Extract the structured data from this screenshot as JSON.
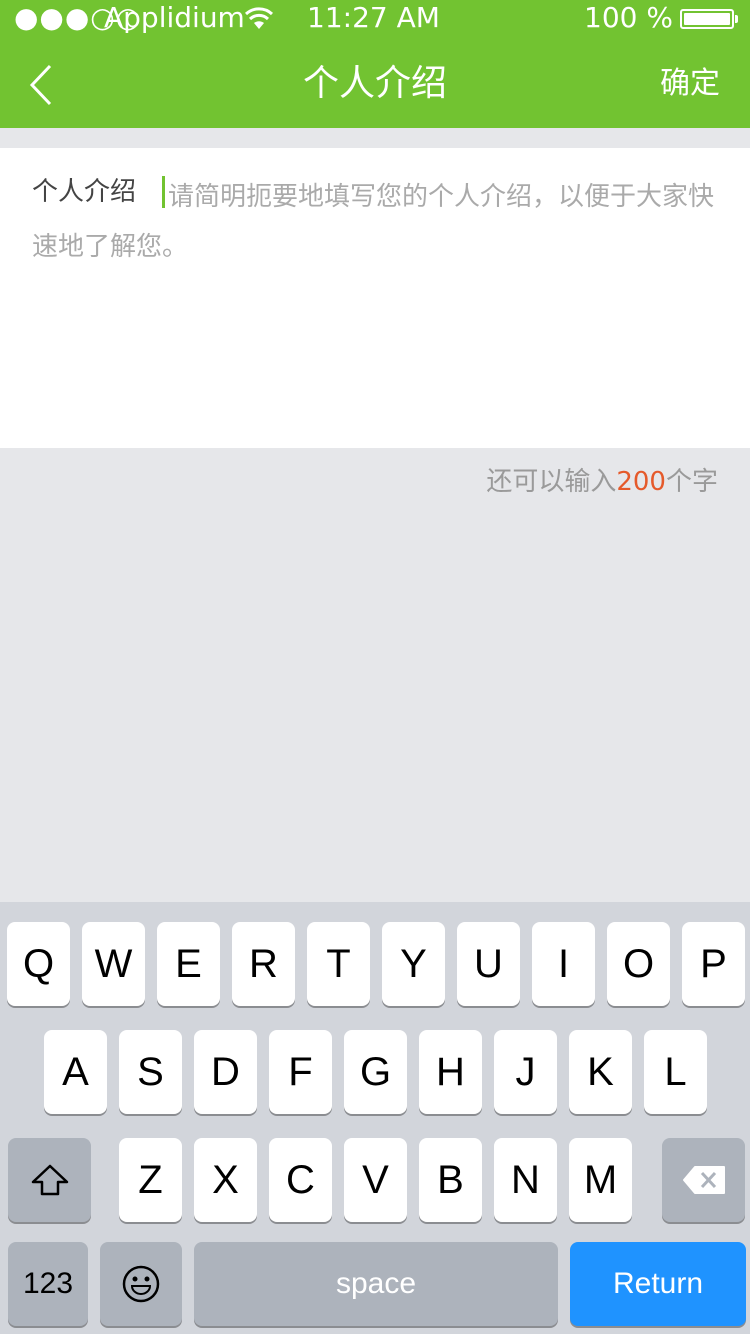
{
  "status_bar": {
    "signal": "●●●○○",
    "carrier": "Applidium",
    "time": "11:27 AM",
    "battery_percent": "100 %"
  },
  "nav": {
    "title": "个人介绍",
    "confirm_label": "确定"
  },
  "intro": {
    "label": "个人介绍",
    "placeholder": "请简明扼要地填写您的个人介绍，以便于大家快速地了解您。"
  },
  "counter": {
    "prefix": "还可以输入",
    "count": "200",
    "suffix": "个字"
  },
  "keyboard": {
    "row1": [
      "Q",
      "W",
      "E",
      "R",
      "T",
      "Y",
      "U",
      "I",
      "O",
      "P"
    ],
    "row2": [
      "A",
      "S",
      "D",
      "F",
      "G",
      "H",
      "J",
      "K",
      "L"
    ],
    "row3": [
      "Z",
      "X",
      "C",
      "V",
      "B",
      "N",
      "M"
    ],
    "numbers_label": "123",
    "space_label": "space",
    "return_label": "Return"
  },
  "colors": {
    "brand_green": "#72c331",
    "counter_highlight": "#e55a2b",
    "return_blue": "#1f93ff"
  }
}
